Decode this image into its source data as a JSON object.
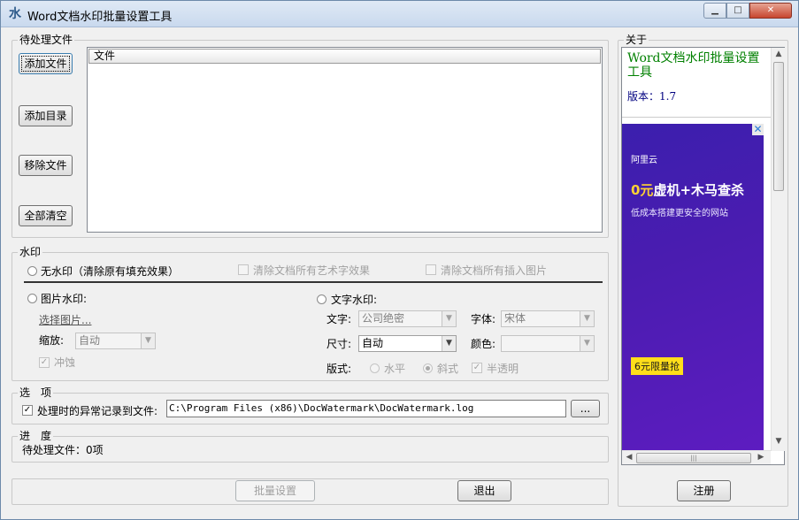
{
  "window": {
    "title": "Word文档水印批量设置工具",
    "icon_name": "app-logo-icon",
    "minimize_label": "▁",
    "maximize_label": "□",
    "close_label": "✕"
  },
  "files": {
    "group_label": "待处理文件",
    "add_file": "添加文件",
    "add_dir": "添加目录",
    "remove_file": "移除文件",
    "clear_all": "全部清空",
    "column_header": "文件"
  },
  "watermark": {
    "group_label": "水印",
    "none_label": "无水印（清除原有填充效果）",
    "clear_art": "清除文档所有艺术字效果",
    "clear_images": "清除文档所有插入图片",
    "image_label": "图片水印:",
    "choose_image": "选择图片...",
    "scale_label": "缩放:",
    "scale_value": "自动",
    "washout_label": "冲蚀",
    "text_label": "文字水印:",
    "text_field_label": "文字:",
    "text_value": "公司绝密",
    "font_label": "字体:",
    "font_value": "宋体",
    "size_label": "尺寸:",
    "size_value": "自动",
    "color_label": "颜色:",
    "color_value": "",
    "layout_label": "版式:",
    "horizontal_label": "水平",
    "diagonal_label": "斜式",
    "semi_transparent_label": "半透明"
  },
  "options": {
    "group_label": "选　项",
    "log_label": "处理时的异常记录到文件:",
    "log_path": "C:\\Program Files (x86)\\DocWatermark\\DocWatermark.log",
    "browse_label": "..."
  },
  "progress": {
    "group_label": "进　度",
    "status_text": "待处理文件：0项"
  },
  "actions": {
    "batch_label": "批量设置",
    "exit_label": "退出",
    "register_label": "注册"
  },
  "about": {
    "group_label": "关于",
    "app_name": "Word文档水印批量设置工具",
    "version_text": "版本：1.7",
    "ad": {
      "brand": "阿里云",
      "headline_accent": "0元",
      "headline_rest": "虚机+木马查杀",
      "subline": "低成本搭建更安全的网站",
      "cta": "6元限量抢",
      "close_label": "✕"
    }
  },
  "colors": {
    "window_bg": "#f0f0f0",
    "about_title_color": "#008000",
    "about_version_color": "#000080",
    "ad_bg": "#4a1cb0",
    "ad_accent": "#ffd233",
    "ad_cta_bg": "#ffde1a"
  }
}
